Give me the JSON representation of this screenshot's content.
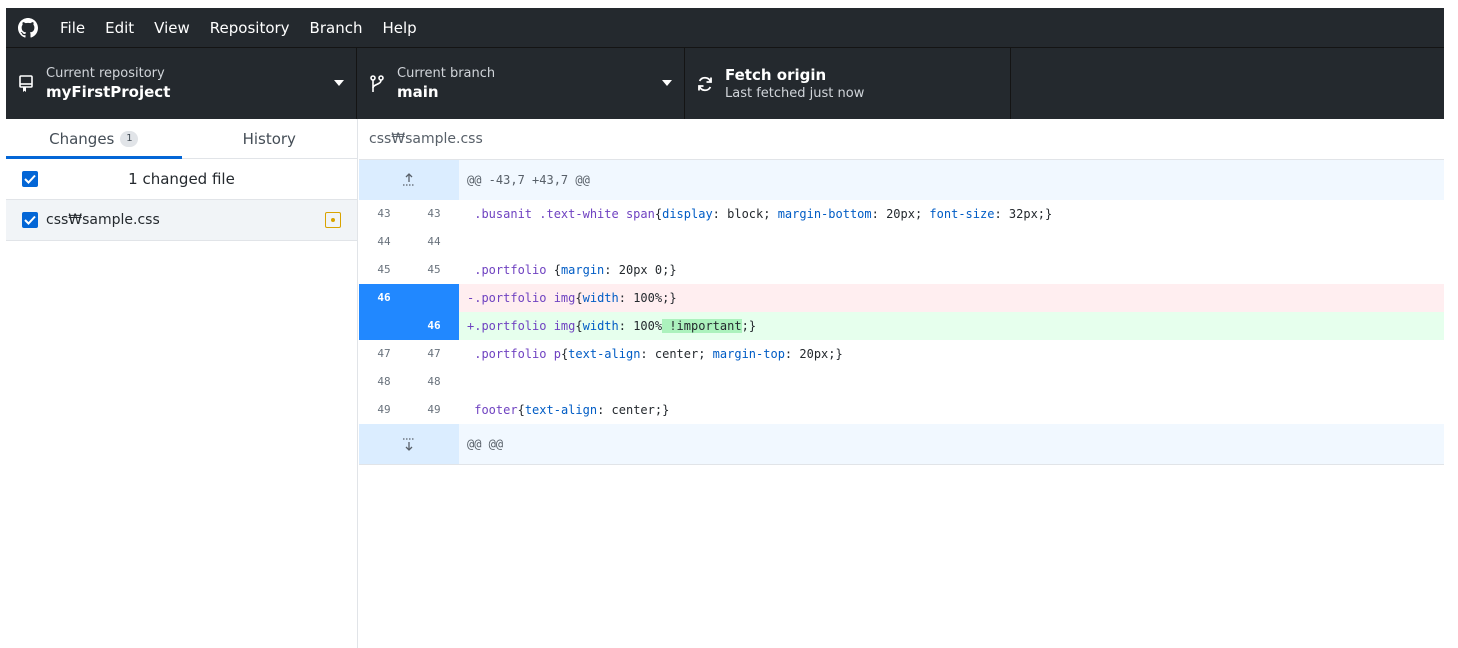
{
  "menu": [
    "File",
    "Edit",
    "View",
    "Repository",
    "Branch",
    "Help"
  ],
  "toolbar": {
    "repo": {
      "caption": "Current repository",
      "value": "myFirstProject"
    },
    "branch": {
      "caption": "Current branch",
      "value": "main"
    },
    "fetch": {
      "title": "Fetch origin",
      "subtitle": "Last fetched just now"
    }
  },
  "sidebar": {
    "tabs": [
      {
        "label": "Changes",
        "count": "1"
      },
      {
        "label": "History"
      }
    ],
    "changed_label": "1 changed file",
    "files": [
      {
        "name": "css₩sample.css"
      }
    ]
  },
  "diff": {
    "file": "css₩sample.css",
    "hunk_top": "@@ -43,7 +43,7 @@",
    "hunk_bottom": "@@ @@",
    "lines": [
      {
        "old": "43",
        "new": "43",
        "type": "ctx",
        "text": " .busanit .text-white span{display: block; margin-bottom: 20px; font-size: 32px;}"
      },
      {
        "old": "44",
        "new": "44",
        "type": "ctx",
        "text": ""
      },
      {
        "old": "45",
        "new": "45",
        "type": "ctx",
        "text": " .portfolio {margin: 20px 0;}"
      },
      {
        "old": "46",
        "new": "",
        "type": "del",
        "text": "-.portfolio img{width: 100%;}"
      },
      {
        "old": "",
        "new": "46",
        "type": "add",
        "text": "+.portfolio img{width: 100% !important;}"
      },
      {
        "old": "47",
        "new": "47",
        "type": "ctx",
        "text": " .portfolio p{text-align: center; margin-top: 20px;}"
      },
      {
        "old": "48",
        "new": "48",
        "type": "ctx",
        "text": ""
      },
      {
        "old": "49",
        "new": "49",
        "type": "ctx",
        "text": " footer{text-align: center;}"
      }
    ],
    "tokens": {
      "l43": {
        "pre": " .busanit .text-white ",
        "sel": "span",
        "a": "{",
        "p1": "display",
        "b": ": block; ",
        "p2": "margin-bottom",
        "c": ": 20px; ",
        "p3": "font-size",
        "d": ": 32px;}"
      },
      "l45": {
        "pre": " .portfolio ",
        "a": "{",
        "p1": "margin",
        "b": ": 20px 0;}"
      },
      "l46d": {
        "pre": "-.portfolio ",
        "sel": "img",
        "a": "{",
        "p1": "width",
        "b": ": 100%;}"
      },
      "l46a": {
        "pre": "+.portfolio ",
        "sel": "img",
        "a": "{",
        "p1": "width",
        "b": ": 100%",
        "hl": " !important",
        "c": ";}"
      },
      "l47": {
        "pre": " .portfolio ",
        "sel": "p",
        "a": "{",
        "p1": "text-align",
        "b": ": center; ",
        "p2": "margin-top",
        "c": ": 20px;}"
      },
      "l49": {
        "pre": " ",
        "sel": "footer",
        "a": "{",
        "p1": "text-align",
        "b": ": center;}"
      }
    }
  },
  "colors": {
    "titlebar": "#24292e",
    "accent": "#0366d6",
    "added_bg": "#e6ffed",
    "removed_bg": "#ffeef0",
    "gutter_selected": "#2188ff"
  }
}
